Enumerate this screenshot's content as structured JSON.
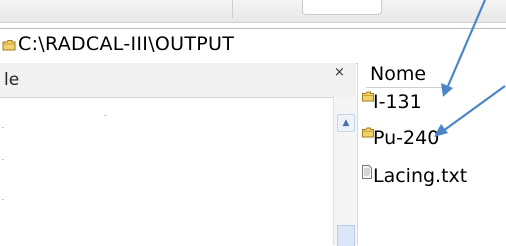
{
  "path_bar": {
    "path": "C:\\RADCAL-III\\OUTPUT"
  },
  "left_pane": {
    "header_label": "le",
    "close_symbol": "×",
    "scroll_up_symbol": "▲"
  },
  "right_pane": {
    "column_header": "Nome",
    "items": [
      {
        "name": "I-131",
        "type": "folder"
      },
      {
        "name": "Pu-240",
        "type": "folder"
      },
      {
        "name": "Lacing.txt",
        "type": "text-file"
      }
    ]
  },
  "icons": {
    "folder": "folder-icon",
    "text_file": "text-file-icon",
    "close": "close-icon",
    "scroll_up": "scroll-up-arrow-icon"
  },
  "colors": {
    "annotation_arrow": "#4a86c5",
    "folder_yellow": "#f2d36b",
    "scrollbar_thumb": "#dbe7f8"
  }
}
